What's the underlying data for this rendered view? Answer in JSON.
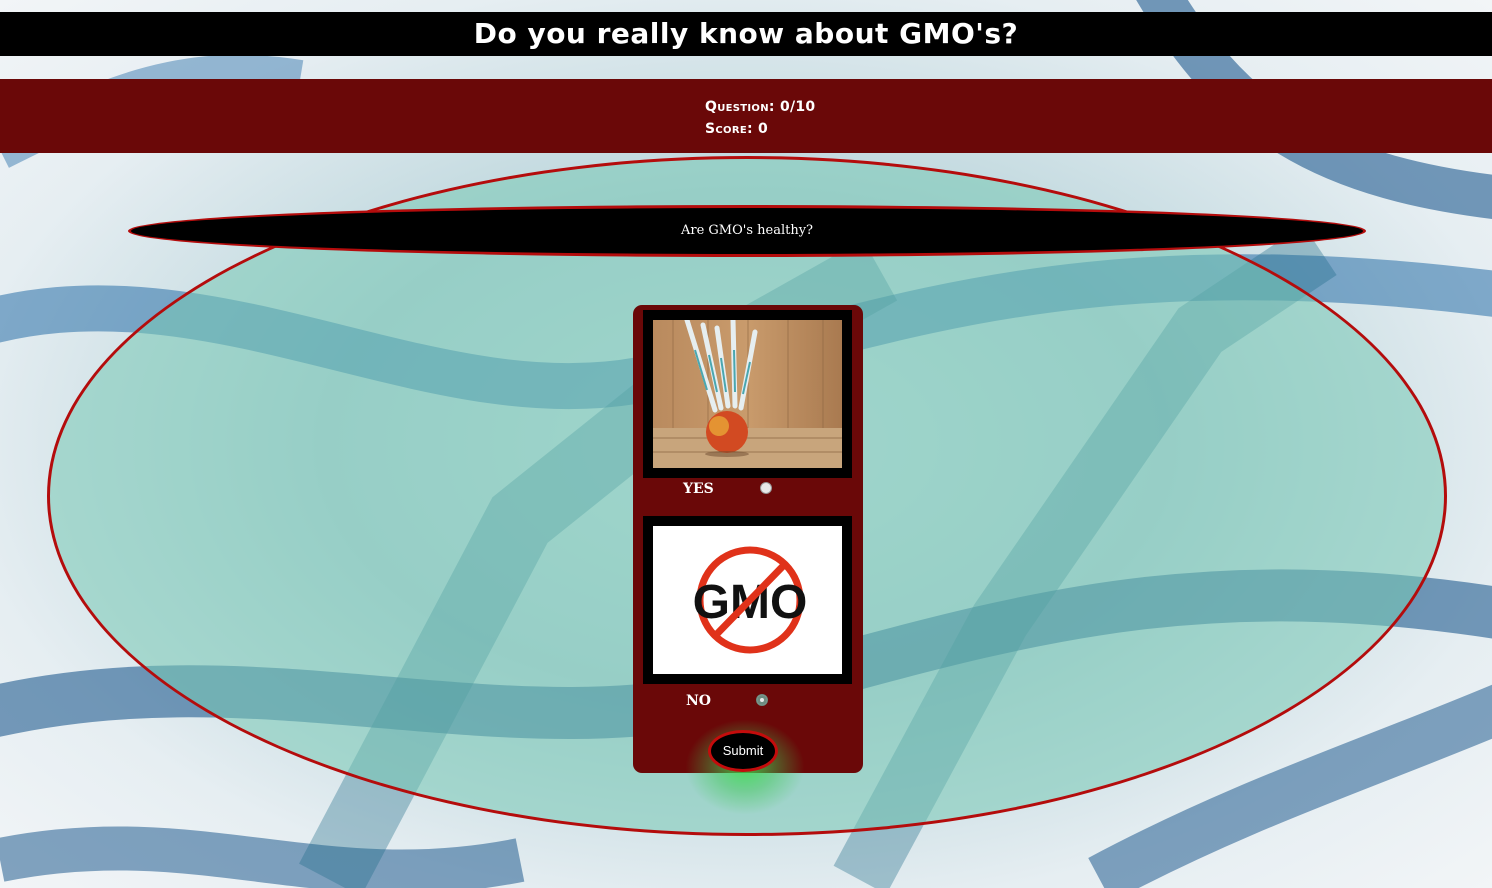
{
  "header": {
    "title": "Do you really know about GMO's?"
  },
  "stats": {
    "question_label": "Question: 0/10",
    "score_label": "Score: 0"
  },
  "quiz": {
    "question": "Are GMO's healthy?",
    "options": [
      {
        "label": "YES",
        "image": "apple-with-syringes-image",
        "selected": false
      },
      {
        "label": "NO",
        "image": "no-gmo-sign-image",
        "selected": true,
        "sign_text": "GMO"
      }
    ],
    "submit_label": "Submit"
  },
  "colors": {
    "title_bar": "#000000",
    "stats_bar": "#6a0808",
    "oval_border": "#b40c0c",
    "card": "#6a0808",
    "glow": "#3cdc50"
  }
}
